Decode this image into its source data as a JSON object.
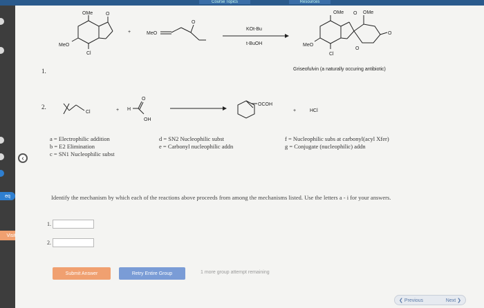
{
  "top_tabs": [
    "Course Topics",
    "Resources"
  ],
  "sidebar": {
    "pills": [
      "eq",
      "Visited"
    ],
    "collapse_icon": "chevron-left-icon"
  },
  "reaction1": {
    "number": "1.",
    "reactant_a": {
      "substituent_top": "OMe",
      "substituent_left": "MeO",
      "substituent_bottom": "Cl",
      "carbonyl": "O"
    },
    "plus": "+",
    "reactant_b": {
      "left_group": "MeO",
      "carbonyl": "O"
    },
    "reagent_top": "KOt-Bu",
    "reagent_bottom": "t-BuOH",
    "product": {
      "substituent_top_left": "OMe",
      "ring_o": "O",
      "substituent_top_right": "OMe",
      "substituent_left": "MeO",
      "substituent_bottom": "Cl",
      "ketone_o": "O",
      "carbonyl_o": "O"
    },
    "caption": "Griseofulvin (a naturally occuring antibiotic)"
  },
  "reaction2": {
    "number": "2.",
    "reactant_a_label": "Cl",
    "plus": "+",
    "reactant_b": {
      "h": "H",
      "carbonyl": "O",
      "oh": "OH"
    },
    "product_label": "OCOH",
    "plus2": "+",
    "byproduct": "HCl"
  },
  "mechanisms": {
    "col1": [
      "a = Electrophilic addition",
      "b = E2 Elimination",
      "c = SN1 Nucleophilic subst"
    ],
    "col2": [
      "d = SN2 Nucleophilic subst",
      "e = Carbonyl nucleophilic addn"
    ],
    "col3": [
      "f = Nucleophilic subs at carbonyl(acyl Xfer)",
      "g = Conjugate (nucleophilic) addn"
    ]
  },
  "question": "Identify the mechanism by which each of the reactions above proceeds from among the mechanisms listed. Use the letters a - i for your answers.",
  "answers": [
    {
      "label": "1.",
      "value": "",
      "placeholder": ""
    },
    {
      "label": "2.",
      "value": "",
      "placeholder": ""
    }
  ],
  "buttons": {
    "submit": "Submit Answer",
    "retry": "Retry Entire Group",
    "attempts": "1 more group attempt remaining"
  },
  "pager": {
    "previous": "Previous",
    "next": "Next"
  },
  "colors": {
    "submit": "#f0a070",
    "retry": "#7a9cd6",
    "topbar": "#2a5a8c",
    "sidebar_pill": "#2f7fd0",
    "visited": "#f0a070"
  }
}
